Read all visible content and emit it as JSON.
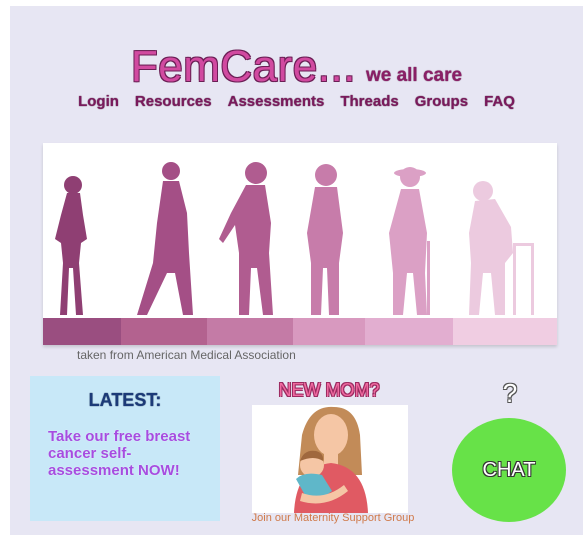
{
  "header": {
    "brand_name": "FemCare...",
    "tagline": "we all care"
  },
  "nav": {
    "items": [
      {
        "label": "Login"
      },
      {
        "label": "Resources"
      },
      {
        "label": "Assessments"
      },
      {
        "label": "Threads"
      },
      {
        "label": "Groups"
      },
      {
        "label": "FAQ"
      }
    ]
  },
  "banner": {
    "caption": "taken from American Medical Association"
  },
  "latest": {
    "title": "LATEST:",
    "body": "Take our free breast cancer self-assessment NOW!"
  },
  "new_mom": {
    "title": "NEW MOM?",
    "link": "Join our Maternity Support Group"
  },
  "chat": {
    "question_mark": "?",
    "label": "CHAT"
  },
  "colors": {
    "background": "#e7e6f3",
    "brand": "#d14aa0",
    "nav": "#7a1a5c",
    "latest_box": "#c8e8f8",
    "latest_text": "#a64de0",
    "chat_button": "#67e248"
  }
}
